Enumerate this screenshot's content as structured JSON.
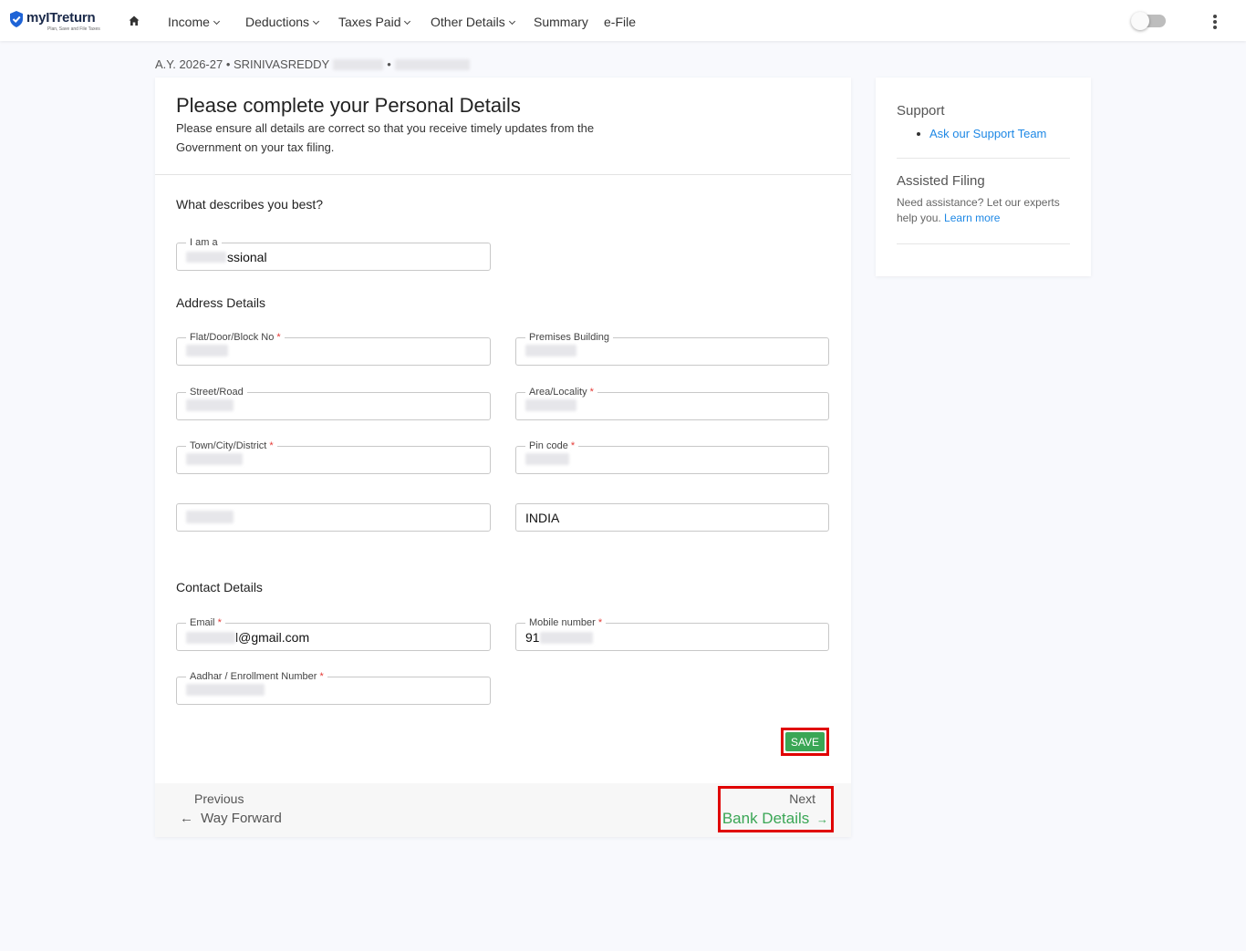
{
  "brand": {
    "name": "myITreturn",
    "tagline": "Plan, Save and File Taxes"
  },
  "nav": [
    {
      "label": "Income",
      "dropdown": true
    },
    {
      "label": "Deductions",
      "dropdown": true
    },
    {
      "label": "Taxes Paid",
      "dropdown": true
    },
    {
      "label": "Other Details",
      "dropdown": true
    },
    {
      "label": "Summary",
      "dropdown": false
    },
    {
      "label": "e-File",
      "dropdown": false
    }
  ],
  "breadcrumb": {
    "text": "A.Y. 2026-27 • SRINIVASREDDY",
    "sep": "•"
  },
  "form": {
    "title": "Please complete your Personal Details",
    "subtitle": "Please ensure all details are correct so that you receive timely updates from the Government on your tax filing.",
    "describes_heading": "What describes you best?",
    "iam_label": "I am a",
    "iam_value_visible": "ssional",
    "address_heading": "Address Details",
    "flat_label": "Flat/Door/Block No",
    "premises_label": "Premises Building",
    "street_label": "Street/Road",
    "area_label": "Area/Locality",
    "town_label": "Town/City/District",
    "pin_label": "Pin code",
    "country_value": "INDIA",
    "contact_heading": "Contact Details",
    "email_label": "Email",
    "email_value_visible": "l@gmail.com",
    "mobile_label": "Mobile number",
    "mobile_value_visible": "91",
    "aadhar_label": "Aadhar / Enrollment Number",
    "required_mark": "*",
    "save_label": "SAVE"
  },
  "footer": {
    "prev_label": "Previous",
    "prev_link": "Way Forward",
    "prev_arrow": "←",
    "next_label": "Next",
    "next_link": "Bank Details",
    "next_arrow": "→"
  },
  "side": {
    "support_heading": "Support",
    "support_link": "Ask our Support Team",
    "assisted_heading": "Assisted Filing",
    "assisted_text": "Need assistance? Let our experts help you.",
    "learn_more": "Learn more"
  },
  "colors": {
    "accent_green": "#3aa655",
    "link_blue": "#1e88e5",
    "highlight_red": "#e00000"
  }
}
